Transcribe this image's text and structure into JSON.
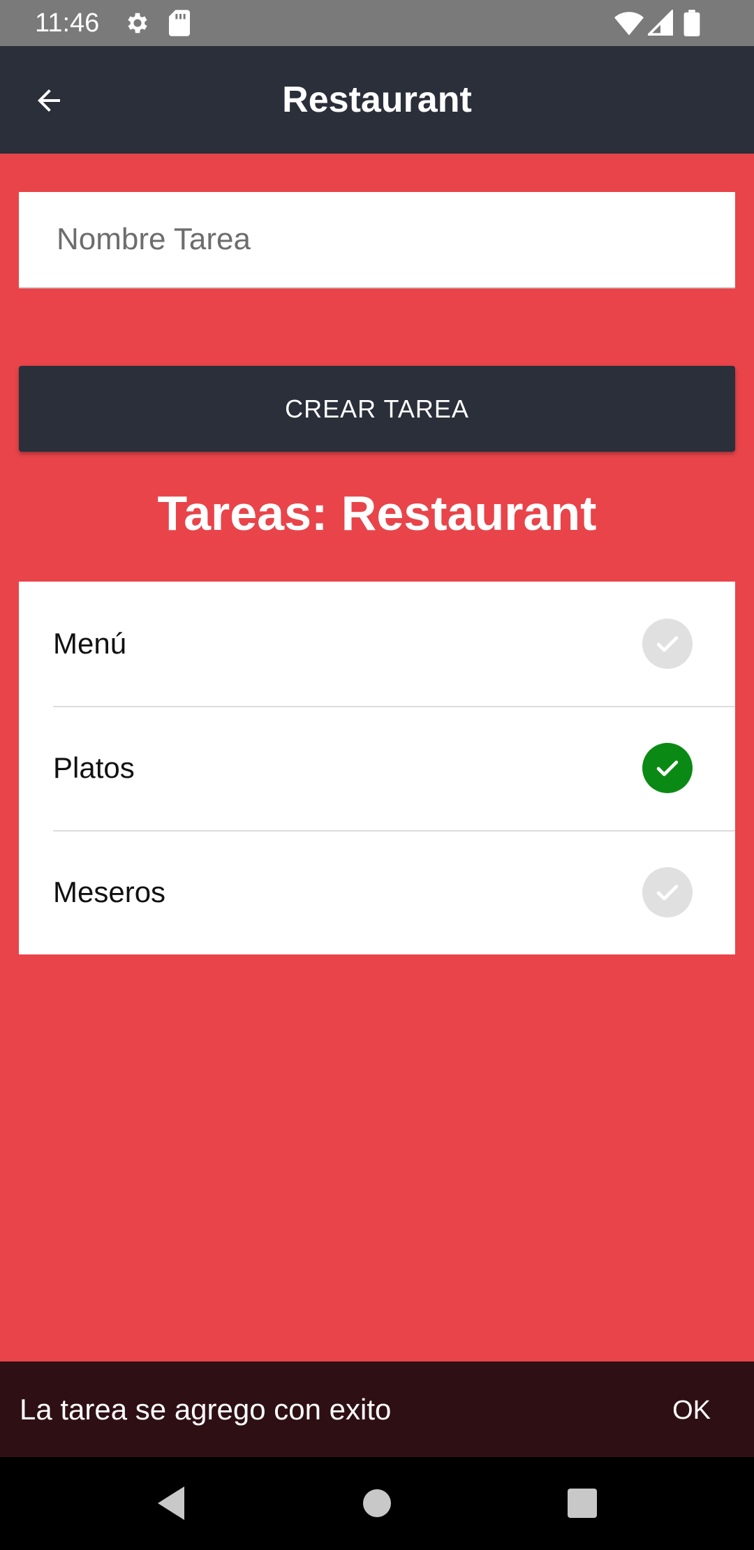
{
  "status_bar": {
    "time": "11:46",
    "icons": [
      "gear-icon",
      "sd-card-icon",
      "wifi-icon",
      "signal-icon",
      "battery-icon"
    ]
  },
  "app_bar": {
    "title": "Restaurant",
    "back_icon": "arrow-back-icon"
  },
  "form": {
    "input_placeholder": "Nombre Tarea",
    "input_value": "",
    "create_button_label": "CREAR TAREA"
  },
  "section_title": "Tareas: Restaurant",
  "tasks": [
    {
      "label": "Menú",
      "done": false
    },
    {
      "label": "Platos",
      "done": true
    },
    {
      "label": "Meseros",
      "done": false
    }
  ],
  "snackbar": {
    "message": "La tarea se agrego con exito",
    "action_label": "OK"
  },
  "colors": {
    "background": "#e8444a",
    "app_bar": "#2a2f3a",
    "check_done": "#0a8a14",
    "check_pending": "#e0e0e0",
    "snackbar": "#2e1014"
  },
  "nav_bar": {
    "buttons": [
      "back-triangle-icon",
      "home-circle-icon",
      "recents-square-icon"
    ]
  }
}
